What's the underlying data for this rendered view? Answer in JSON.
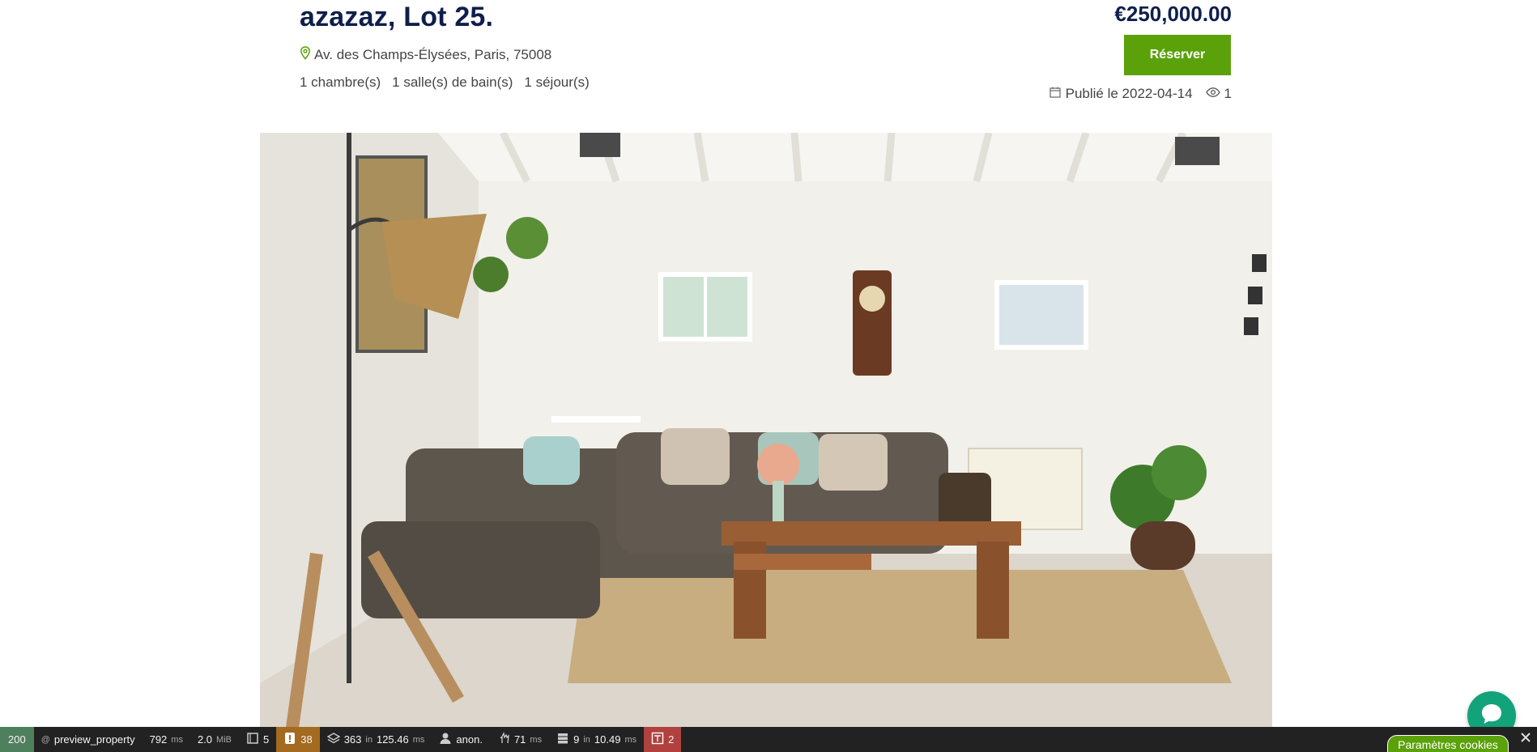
{
  "property": {
    "title": "azazaz, Lot 25.",
    "address": "Av. des Champs-Élysées, Paris, 75008",
    "features": [
      "1 chambre(s)",
      "1 salle(s) de bain(s)",
      "1 séjour(s)"
    ],
    "price": "€250,000.00",
    "reserve_label": "Réserver",
    "published": "Publié le 2022-04-14",
    "views": "1"
  },
  "toolbar": {
    "status": "200",
    "route": "preview_property",
    "time_value": "792",
    "time_unit": "ms",
    "memory_value": "2.0",
    "memory_unit": "MiB",
    "forms": "5",
    "warnings": "38",
    "twig_value": "363",
    "twig_in": "in",
    "twig_time": "125.46",
    "twig_unit": "ms",
    "user": "anon.",
    "events_value": "71",
    "events_unit": "ms",
    "db_value": "9",
    "db_in": "in",
    "db_time": "10.49",
    "db_unit": "ms",
    "errors": "2"
  },
  "cookies": {
    "label": "Paramètres cookies"
  },
  "colors": {
    "accent_green": "#5ba10a",
    "title_navy": "#0f1f4b",
    "chat_green": "#12a37a",
    "toolbar_bg": "#222222"
  }
}
